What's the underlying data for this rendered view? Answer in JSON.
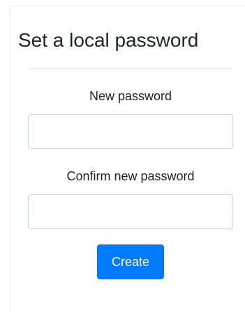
{
  "form": {
    "title": "Set a local password",
    "new_password_label": "New password",
    "new_password_value": "",
    "confirm_password_label": "Confirm new password",
    "confirm_password_value": "",
    "submit_label": "Create"
  },
  "colors": {
    "primary": "#007bff",
    "text": "#212529",
    "border": "#ced4da",
    "divider": "#e3e6ea"
  }
}
